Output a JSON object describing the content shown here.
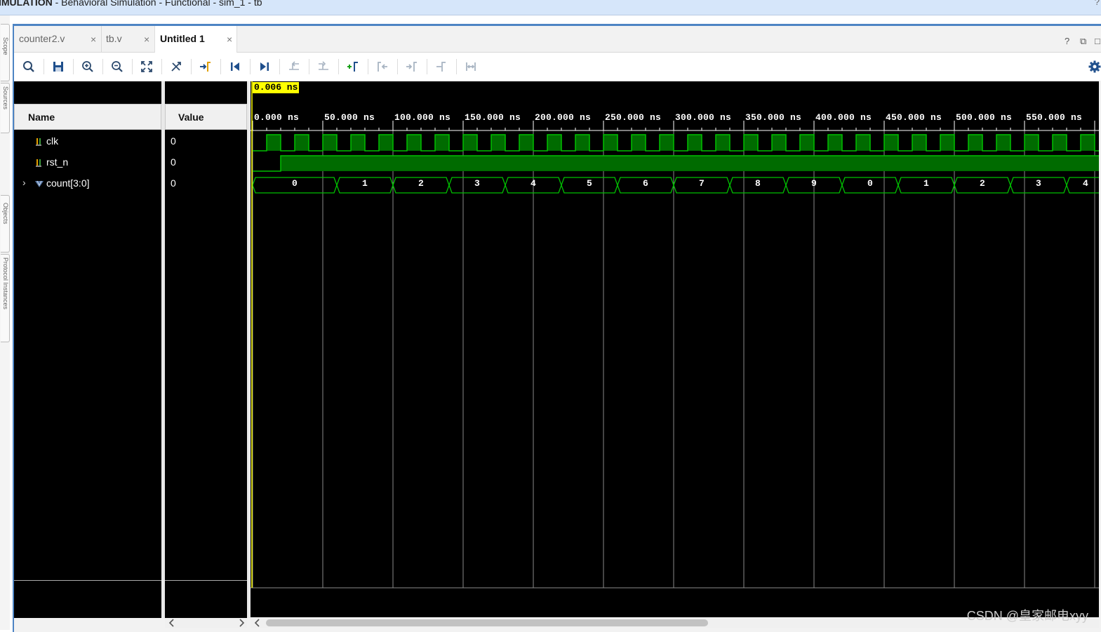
{
  "window": {
    "title_bold": "IMULATION",
    "title_rest": " - Behavioral Simulation - Functional - sim_1 - tb",
    "help": "?"
  },
  "tabs": [
    {
      "label": "counter2.v",
      "close": "×"
    },
    {
      "label": "tb.v",
      "close": "×"
    },
    {
      "label": "Untitled 1",
      "close": "×"
    }
  ],
  "tab_controls": {
    "help": "?",
    "restore": "⧉",
    "maximize": "□"
  },
  "toolbar": [
    "search-icon",
    "save-icon",
    "zoom-in-icon",
    "zoom-out-icon",
    "zoom-fit-icon",
    "cursor-snap-icon",
    "go-to-cursor-icon",
    "go-to-time-zero-icon",
    "go-to-last-time-icon",
    "previous-transition-icon",
    "next-transition-icon",
    "add-marker-icon",
    "previous-marker-icon",
    "next-marker-icon",
    "swap-cursors-icon",
    "cursor-marker-span-icon",
    "settings-icon"
  ],
  "columns": {
    "name": "Name",
    "value": "Value"
  },
  "signals": [
    {
      "name": "clk",
      "value": "0",
      "type": "scalar"
    },
    {
      "name": "rst_n",
      "value": "0",
      "type": "scalar"
    },
    {
      "name": "count[3:0]",
      "value": "0",
      "type": "bus"
    }
  ],
  "cursor": {
    "label": "0.006 ns"
  },
  "time_axis": {
    "unit": "ns",
    "major_step_ns": 50,
    "labels": [
      "0.000 ns",
      "50.000 ns",
      "100.000 ns",
      "150.000 ns",
      "200.000 ns",
      "250.000 ns",
      "300.000 ns",
      "350.000 ns",
      "400.000 ns",
      "450.000 ns",
      "500.000 ns",
      "550.000 ns"
    ]
  },
  "waveforms": {
    "clk": {
      "period_ns": 20,
      "high_start_ns": 10,
      "low_start_ns": 20,
      "visible_until_ns": 600
    },
    "rst_n": {
      "low_until_ns": 20
    },
    "count": {
      "values": [
        "0",
        "1",
        "2",
        "3",
        "4",
        "5",
        "6",
        "7",
        "8",
        "9",
        "0",
        "1",
        "2",
        "3",
        "4"
      ],
      "change_times_ns": [
        0,
        60,
        100,
        140,
        180,
        220,
        260,
        300,
        340,
        380,
        420,
        460,
        500,
        540,
        580
      ]
    }
  },
  "side_tabs": [
    "Scope",
    "Sources",
    "Objects",
    "Protocol Instances"
  ],
  "watermark": "CSDN @皇家邮电xyy",
  "colors": {
    "wave_green": "#00c000",
    "wave_fill": "#006b00",
    "background": "#000000",
    "cursor": "#ffff00",
    "accent": "#4d84c4"
  }
}
